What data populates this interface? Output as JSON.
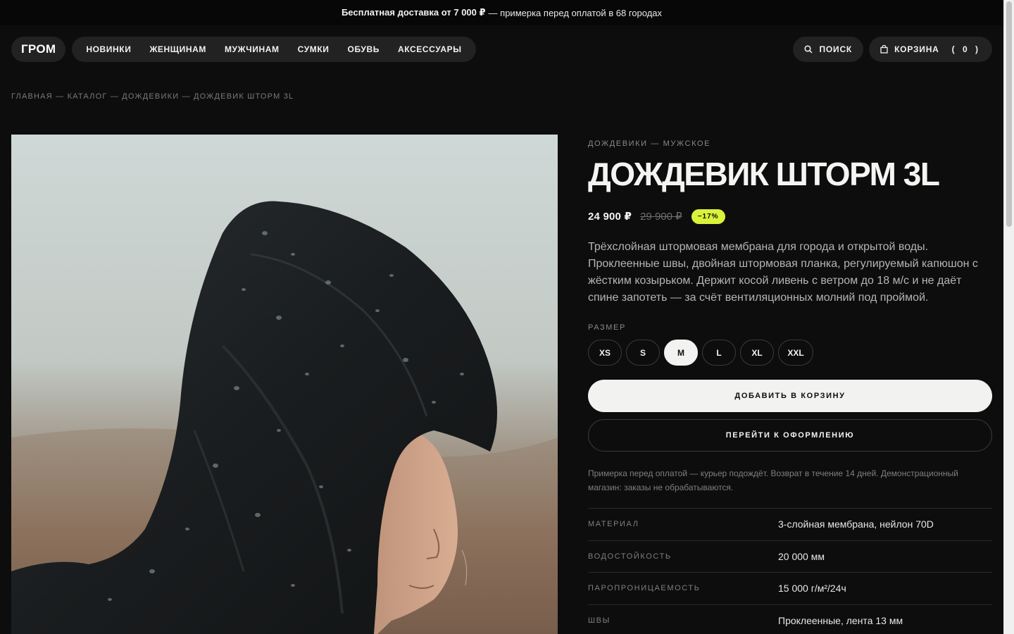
{
  "promo": {
    "bold": "Бесплатная доставка от 7 000 ₽",
    "rest": "— примерка перед оплатой в 68 городах"
  },
  "header": {
    "logo": "ГРОМ",
    "nav": [
      "НОВИНКИ",
      "ЖЕНЩИНАМ",
      "МУЖЧИНАМ",
      "СУМКИ",
      "ОБУВЬ",
      "АКСЕССУАРЫ"
    ],
    "search_label": "ПОИСК",
    "cart_label": "КОРЗИНА",
    "cart_count": "( 0 )"
  },
  "breadcrumb": "ГЛАВНАЯ — КАТАЛОГ — ДОЖДЕВИКИ — ДОЖДЕВИК ШТОРМ 3L",
  "product": {
    "category": "ДОЖДЕВИКИ — МУЖСКОЕ",
    "title": "ДОЖДЕВИК ШТОРМ 3L",
    "price": "24 900 ₽",
    "old_price": "29 900 ₽",
    "discount": "−17%",
    "description": "Трёхслойная штормовая мембрана для города и открытой воды. Проклеенные швы, двойная штормовая планка, регулируемый капюшон с жёстким козырьком. Держит косой ливень с ветром до 18 м/с и не даёт спине запотеть — за счёт вентиляционных молний под проймой.",
    "size_label": "РАЗМЕР",
    "sizes": [
      "XS",
      "S",
      "M",
      "L",
      "XL",
      "XXL"
    ],
    "selected_size": "M",
    "add_to_cart": "ДОБАВИТЬ В КОРЗИНУ",
    "checkout": "ПЕРЕЙТИ К ОФОРМЛЕНИЮ",
    "note": "Примерка перед оплатой — курьер подождёт. Возврат в течение 14 дней. Демонстрационный магазин: заказы не обрабатываются.",
    "specs": [
      {
        "key": "МАТЕРИАЛ",
        "value": "3-слойная мембрана, нейлон 70D"
      },
      {
        "key": "ВОДОСТОЙКОСТЬ",
        "value": "20 000 мм"
      },
      {
        "key": "ПАРОПРОНИЦАЕМОСТЬ",
        "value": "15 000 г/м²/24ч"
      },
      {
        "key": "ШВЫ",
        "value": "Проклеенные, лента 13 мм"
      }
    ]
  },
  "colors": {
    "background": "#0d0d0d",
    "accent": "#d9f23a",
    "pill": "#222222"
  }
}
